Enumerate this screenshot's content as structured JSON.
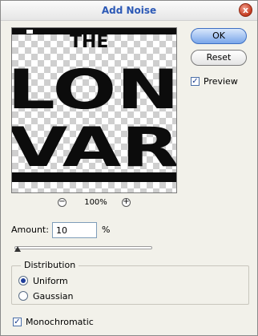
{
  "dialog": {
    "title": "Add Noise",
    "close_glyph": "x"
  },
  "preview": {
    "zoom_level": "100%",
    "zoom_out_glyph": "−",
    "zoom_in_glyph": "+",
    "art_lines": [
      "THE",
      "LON",
      "VAR"
    ]
  },
  "buttons": {
    "ok_label": "OK",
    "reset_label": "Reset"
  },
  "preview_option": {
    "label": "Preview",
    "checked": true,
    "check_glyph": "✓"
  },
  "amount": {
    "label": "Amount:",
    "value": "10",
    "unit": "%",
    "slider_fraction": 0.025
  },
  "distribution": {
    "title": "Distribution",
    "options": [
      {
        "label": "Uniform",
        "selected": true
      },
      {
        "label": "Gaussian",
        "selected": false
      }
    ]
  },
  "monochromatic": {
    "label": "Monochromatic",
    "checked": true,
    "check_glyph": "✓"
  }
}
